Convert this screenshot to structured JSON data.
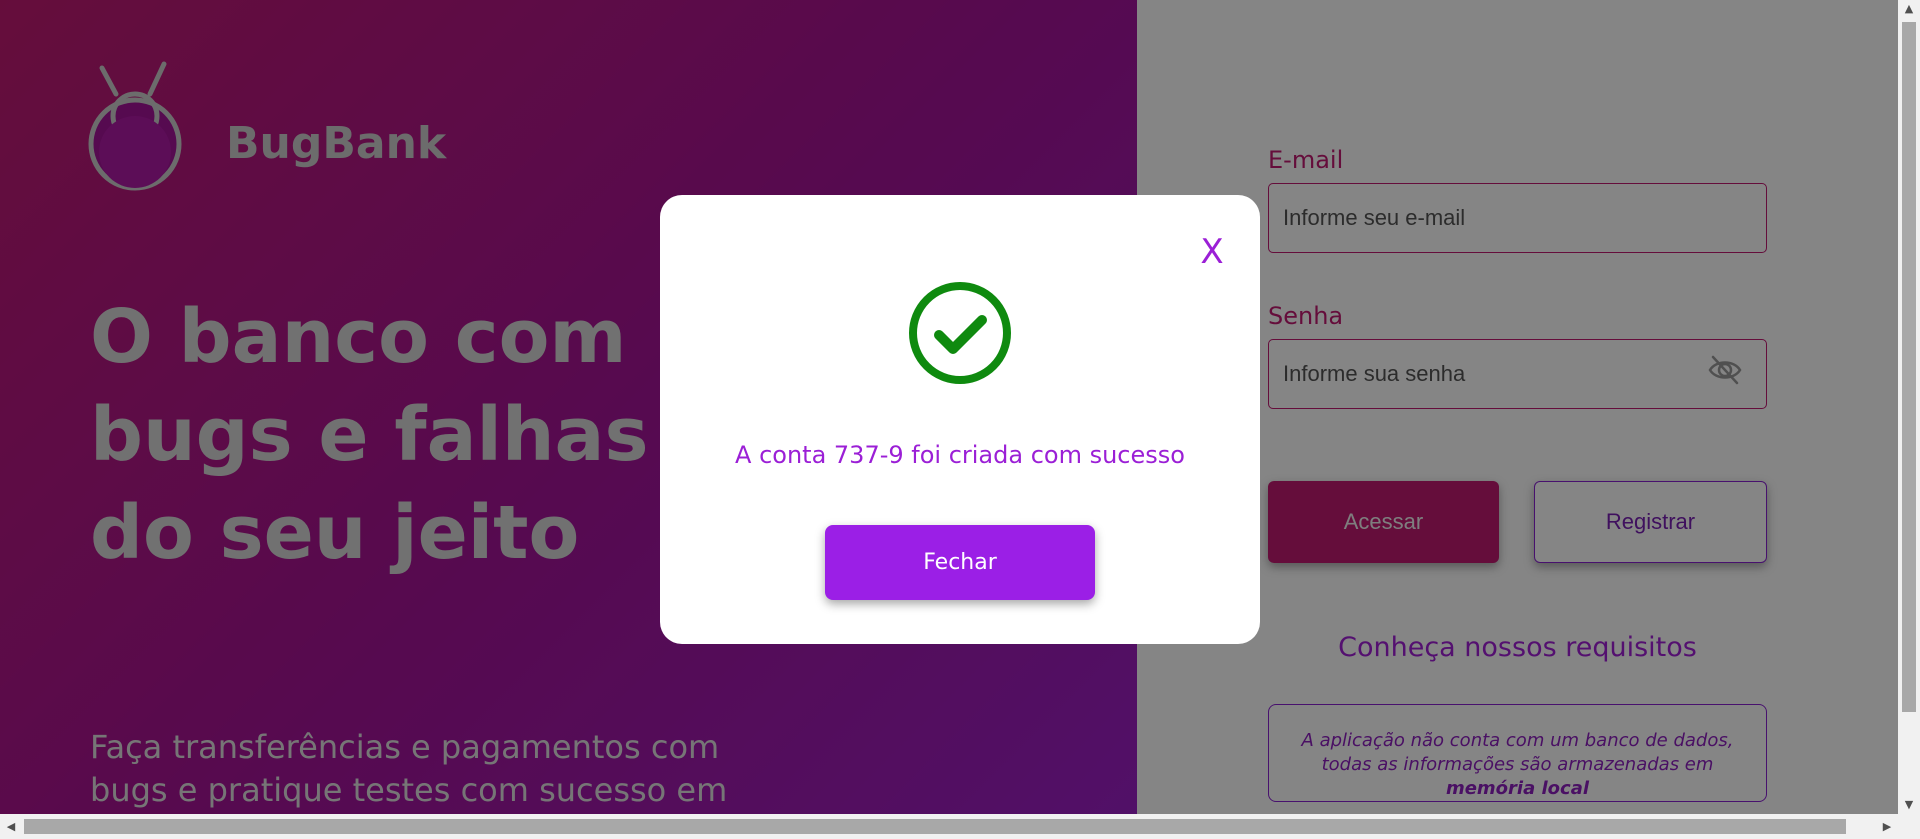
{
  "brand": {
    "name": "BugBank",
    "logo_icon": "bug-icon"
  },
  "hero": {
    "title_lines": [
      "O banco com",
      "bugs e falhas",
      "do seu jeito"
    ],
    "subtitle_lines": [
      "Faça transferências e pagamentos com",
      "bugs e pratique testes com sucesso em"
    ]
  },
  "login_form": {
    "email_label": "E-mail",
    "email_placeholder": "Informe seu e-mail",
    "password_label": "Senha",
    "password_placeholder": "Informe sua senha",
    "password_toggle_icon": "eye-off-icon",
    "access_button": "Acessar",
    "register_button": "Registrar"
  },
  "requirements": {
    "title": "Conheça nossos requisitos",
    "text": "A aplicação não conta com um banco de dados, todas as informações são armazenadas em",
    "text_bold": "memória local"
  },
  "modal": {
    "close_label": "X",
    "icon": "check-circle-icon",
    "message": "A conta 737-9 foi criada com sucesso",
    "button": "Fechar"
  },
  "colors": {
    "brand_magenta": "#c21a72",
    "brand_purple": "#9b1fe6",
    "success_green": "#0f8a0f"
  }
}
